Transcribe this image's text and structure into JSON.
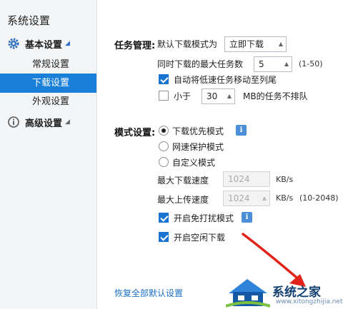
{
  "sidebar": {
    "title": "系统设置",
    "groups": {
      "basic": {
        "label": "基本设置",
        "icon": "gear-icon"
      },
      "advanced": {
        "label": "高级设置",
        "icon": "info-circle-icon"
      }
    },
    "items": [
      {
        "label": "常规设置",
        "active": false
      },
      {
        "label": "下载设置",
        "active": true
      },
      {
        "label": "外观设置",
        "active": false
      }
    ]
  },
  "task_management": {
    "section_label": "任务管理:",
    "default_mode_label": "默认下载模式为",
    "default_mode_value": "立即下载",
    "max_tasks_label": "同时下载的最大任务数",
    "max_tasks_value": "5",
    "max_tasks_range": "(1-50)",
    "auto_move_label": "自动将低速任务移动至列尾",
    "auto_move_checked": true,
    "less_than_label": "小于",
    "less_than_checked": false,
    "less_than_value": "30",
    "no_queue_label": "MB的任务不排队"
  },
  "mode_settings": {
    "section_label": "模式设置:",
    "options": [
      {
        "label": "下载优先模式",
        "selected": true
      },
      {
        "label": "网速保护模式",
        "selected": false
      },
      {
        "label": "自定义模式",
        "selected": false
      }
    ],
    "max_download_label": "最大下载速度",
    "max_download_value": "1024",
    "max_download_unit": "KB/s",
    "max_upload_label": "最大上传速度",
    "max_upload_value": "1024",
    "max_upload_unit": "KB/s",
    "max_upload_range": "(10-2048)",
    "no_disturb_label": "开启免打扰模式",
    "no_disturb_checked": true,
    "idle_download_label": "开启空闲下载",
    "idle_download_checked": true
  },
  "footer": {
    "restore_defaults": "恢复全部默认设置"
  },
  "watermark": {
    "text": "系统之家",
    "url": "www.xitongzhijia.net"
  },
  "colors": {
    "accent": "#1a7fd8",
    "arrow": "#e2231a"
  }
}
